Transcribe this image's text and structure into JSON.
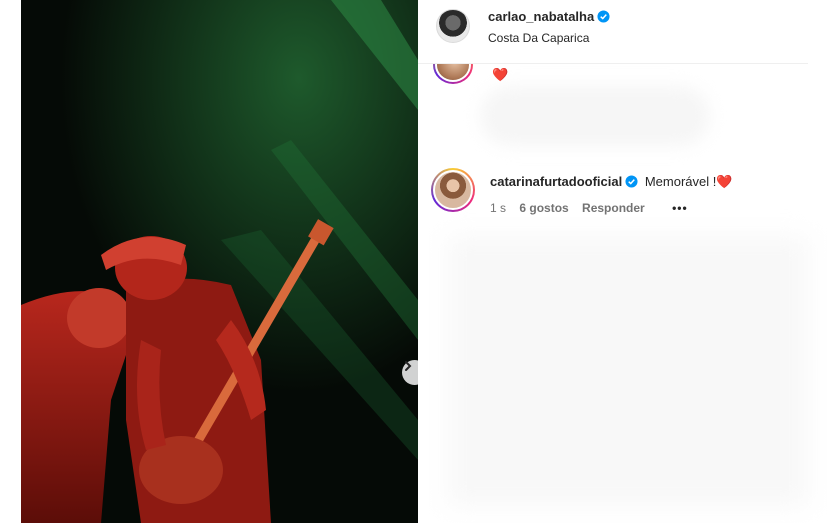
{
  "post": {
    "author": "carlao_nabatalha",
    "location": "Costa Da Caparica"
  },
  "comments": [
    {
      "text": "❤️"
    },
    {
      "user": "catarinafurtadooficial",
      "text": "Memorável !",
      "emoji": "❤️",
      "time": "1 s",
      "likes": "6 gostos",
      "reply": "Responder",
      "more": "•••"
    }
  ],
  "icons": {
    "verified": "verified-badge-icon",
    "next": "chevron-right-icon",
    "more": "more-options-icon"
  },
  "colors": {
    "verified": "#0095f6",
    "heart": "#ff3b6b",
    "photo_red": "#c0271c",
    "photo_green": "#1f7a3a"
  }
}
